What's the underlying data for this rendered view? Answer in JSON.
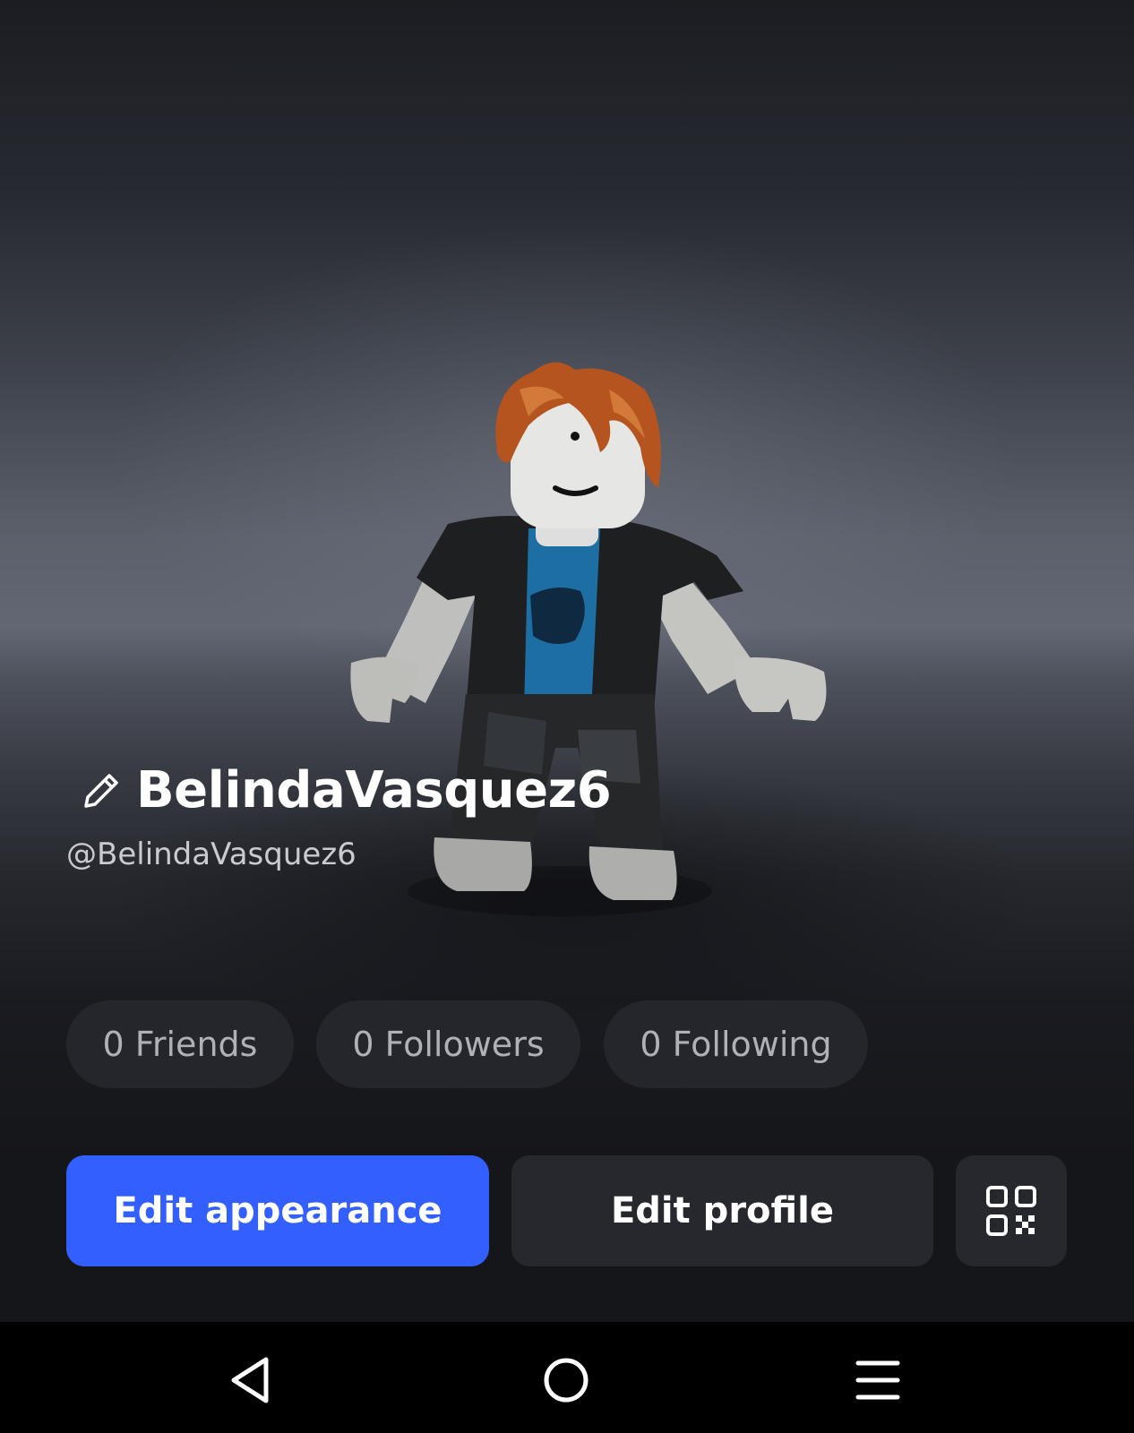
{
  "profile": {
    "display_name": "BelindaVasquez6",
    "username": "@BelindaVasquez6"
  },
  "stats": {
    "friends": "0 Friends",
    "followers": "0 Followers",
    "following": "0 Following"
  },
  "actions": {
    "edit_appearance": "Edit appearance",
    "edit_profile": "Edit profile",
    "qr_icon": "qr-code-icon"
  },
  "navigation": {
    "back_icon": "back-triangle-icon",
    "home_icon": "home-circle-icon",
    "menu_icon": "menu-lines-icon"
  },
  "colors": {
    "primary_button": "#335fff",
    "secondary_button": "#26282e",
    "pill_background": "#24262c"
  }
}
